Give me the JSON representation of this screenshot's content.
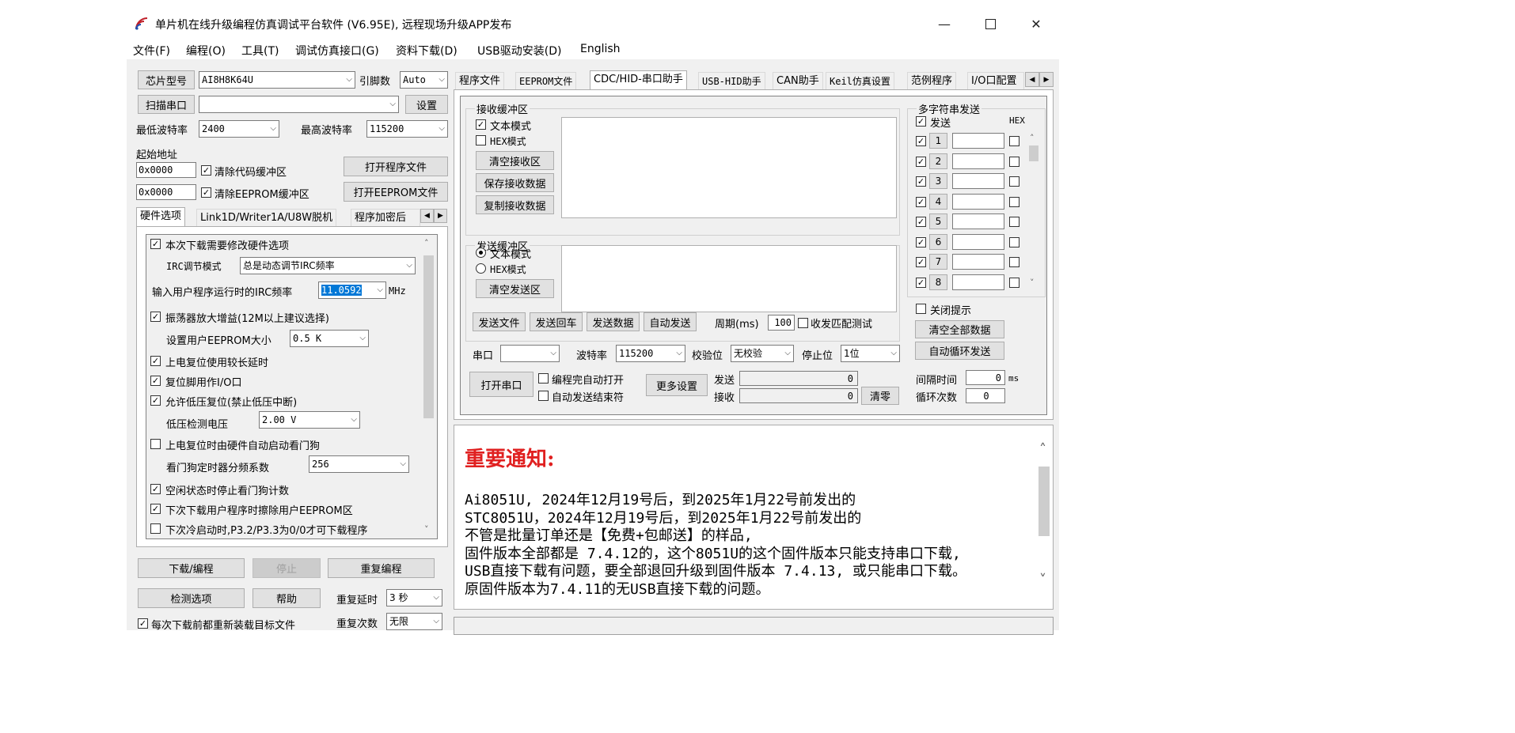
{
  "window": {
    "title": "单片机在线升级编程仿真调试平台软件 (V6.95E), 远程现场升级APP发布"
  },
  "menu": [
    "文件(F)",
    "编程(O)",
    "工具(T)",
    "调试仿真接口(G)",
    "资料下载(D)",
    "USB驱动安装(D)",
    "English"
  ],
  "left": {
    "chip_type_label": "芯片型号",
    "chip_type_value": "AI8H8K64U",
    "pins_label": "引脚数",
    "pins_value": "Auto",
    "scan_port_label": "扫描串口",
    "port_value": "",
    "settings_label": "设置",
    "min_baud_label": "最低波特率",
    "min_baud_value": "2400",
    "max_baud_label": "最高波特率",
    "max_baud_value": "115200",
    "start_addr_label": "起始地址",
    "code_addr": "0x0000",
    "clear_code_label": "清除代码缓冲区",
    "open_prog_label": "打开程序文件",
    "eeprom_addr": "0x0000",
    "clear_eeprom_label": "清除EEPROM缓冲区",
    "open_eeprom_label": "打开EEPROM文件",
    "tabs": [
      "硬件选项",
      "Link1D/Writer1A/U8W脱机",
      "程序加密后"
    ],
    "hw": {
      "opt1": "本次下载需要修改硬件选项",
      "irc_mode_label": "IRC调节模式",
      "irc_mode_value": "总是动态调节IRC频率",
      "irc_freq_label": "输入用户程序运行时的IRC频率",
      "irc_freq_value": "11.0592",
      "mhz": "MHz",
      "opt2": "振荡器放大增益(12M以上建议选择)",
      "eeprom_size_label": "设置用户EEPROM大小",
      "eeprom_size_value": "0.5 K",
      "opt3": "上电复位使用较长延时",
      "opt4": "复位脚用作I/O口",
      "opt5": "允许低压复位(禁止低压中断)",
      "lvd_label": "低压检测电压",
      "lvd_value": "2.00 V",
      "opt6": "上电复位时由硬件自动启动看门狗",
      "wdt_label": "看门狗定时器分频系数",
      "wdt_value": "256",
      "opt7": "空闲状态时停止看门狗计数",
      "opt8": "下次下载用户程序时擦除用户EEPROM区",
      "opt9": "下次冷启动时,P3.2/P3.3为0/0才可下载程序"
    },
    "download_label": "下载/编程",
    "stop_label": "停止",
    "reprogram_label": "重复编程",
    "check_label": "检测选项",
    "help_label": "帮助",
    "repeat_delay_label": "重复延时",
    "repeat_delay_value": "3 秒",
    "repeat_count_label": "重复次数",
    "repeat_count_value": "无限",
    "reload_label": "每次下载前都重新装载目标文件"
  },
  "right": {
    "tabs": [
      "程序文件",
      "EEPROM文件",
      "CDC/HID-串口助手",
      "USB-HID助手",
      "CAN助手",
      "Keil仿真设置",
      "范例程序",
      "I/O口配置"
    ],
    "recv_group": "接收缓冲区",
    "text_mode": "文本模式",
    "hex_mode": "HEX模式",
    "clear_recv": "清空接收区",
    "save_recv": "保存接收数据",
    "copy_recv": "复制接收数据",
    "send_group": "发送缓冲区",
    "clear_send": "清空发送区",
    "send_file": "发送文件",
    "send_cr": "发送回车",
    "send_data": "发送数据",
    "auto_send": "自动发送",
    "period_label": "周期(ms)",
    "period_value": "100",
    "match_test": "收发匹配测试",
    "port_label": "串口",
    "port_value": "",
    "baud_label": "波特率",
    "baud_value": "115200",
    "parity_label": "校验位",
    "parity_value": "无校验",
    "stop_label": "停止位",
    "stop_value": "1位",
    "open_port": "打开串口",
    "auto_open": "编程完自动打开",
    "auto_end": "自动发送结束符",
    "more_settings": "更多设置",
    "send_count_label": "发送",
    "send_count": "0",
    "recv_count_label": "接收",
    "recv_count": "0",
    "clear_count": "清零",
    "multi_group": "多字符串发送",
    "send_col": "发送",
    "hex_col": "HEX",
    "rows": [
      "1",
      "2",
      "3",
      "4",
      "5",
      "6",
      "7",
      "8"
    ],
    "close_tip": "关闭提示",
    "clear_all": "清空全部数据",
    "auto_loop": "自动循环发送",
    "interval_label": "间隔时间",
    "interval_value": "0",
    "ms": "ms",
    "loop_label": "循环次数",
    "loop_value": "0"
  },
  "notice": {
    "title": "重要通知:",
    "lines": [
      "Ai8051U,  2024年12月19号后，到2025年1月22号前发出的",
      "STC8051U，2024年12月19号后，到2025年1月22号前发出的",
      "不管是批量订单还是【免费+包邮送】的样品,",
      "固件版本全部都是 7.4.12的，这个8051U的这个固件版本只能支持串口下载,",
      "USB直接下载有问题，要全部退回升级到固件版本 7.4.13, 或只能串口下载。",
      "原固件版本为7.4.11的无USB直接下载的问题。"
    ]
  },
  "colors": {
    "notice_title": "#e02020",
    "selection": "#0078d7",
    "window_bg": "#f0f0f0"
  }
}
